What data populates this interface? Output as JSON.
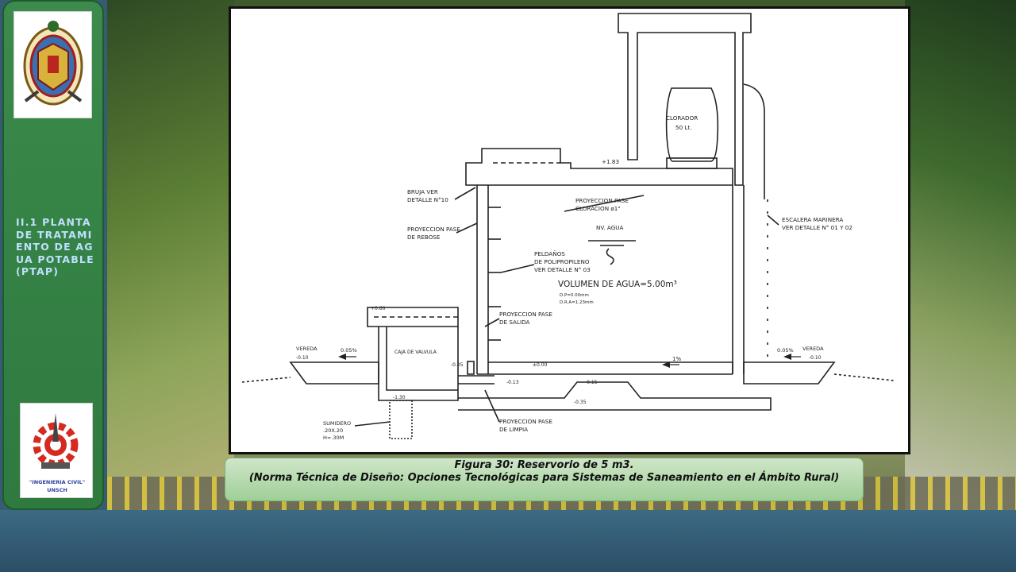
{
  "sidebar": {
    "section_title": "II.1 PLANTA DE TRATAMIENTO DE AGUA POTABLE (PTAP)",
    "logo_bottom_text_1": "\"INGENIERIA CIVIL\"",
    "logo_bottom_text_2": "UNSCH"
  },
  "drawing": {
    "labels": {
      "clorador_1": "CLORADOR",
      "clorador_2": "50 Lt.",
      "cota_sup": "+1.83",
      "brujula_1": "BRUJA VER",
      "brujula_2": "DETALLE N°10",
      "proy_cloracion_1": "PROYECCION PASE",
      "proy_cloracion_2": "CLORACION ø1\"",
      "escalera_1": "ESCALERA MARINERA",
      "escalera_2": "VER DETALLE N° 01 Y 02",
      "proy_rebose_1": "PROYECCION PASE",
      "proy_rebose_2": "DE REBOSE",
      "nv_agua": "NV. AGUA",
      "peldanos_1": "PELDAÑOS",
      "peldanos_2": "DE POLIPROPILENO",
      "peldanos_3": "VER DETALLE N° 03",
      "volumen": "VOLUMEN DE AGUA=5.00m³",
      "dim_1": "D.P=0.00mm",
      "dim_2": "D.R.A=1.23mm",
      "cota_caja": "+0.60",
      "proy_salida_1": "PROYECCION PASE",
      "proy_salida_2": "DE SALIDA",
      "vereda_izq": "VEREDA",
      "cota_vereda_izq": "-0.10",
      "pend_izq": "0.05%",
      "caja_valvula": "CAJA DE VALVULA",
      "cota_caja_int": "-0.05",
      "cota_piso_1": "±0.00",
      "pend_interior": "1%",
      "pend_der": "0.05%",
      "vereda_der": "VEREDA",
      "cota_vereda_der": "-0.10",
      "cota_1": "-0.13",
      "cota_2": "-0.15",
      "cota_3": "-0.35",
      "cota_sumidero": "-1.30",
      "sumidero_1": "SUMIDERO",
      "sumidero_2": ".20X.20",
      "sumidero_3": "H=.30M",
      "proy_limpia_1": "PROYECCION PASE",
      "proy_limpia_2": "DE LIMPIA"
    }
  },
  "caption": {
    "line1": "Figura 30: Reservorio de 5 m3.",
    "line2": "(Norma Técnica de Diseño: Opciones Tecnológicas para Sistemas de Saneamiento en el Ámbito Rural)"
  }
}
